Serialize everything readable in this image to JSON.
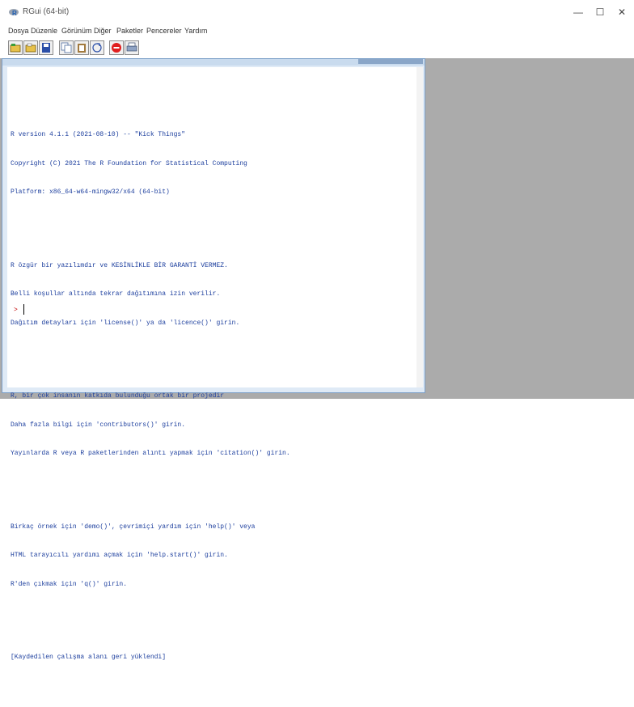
{
  "window": {
    "title": "RGui (64-bit)",
    "controls": {
      "minimize": "—",
      "maximize": "☐",
      "close": "✕"
    }
  },
  "menu": {
    "items": [
      "Dosya",
      "Düzenle",
      "Görünüm",
      "Diğer",
      "Paketler",
      "Pencereler",
      "Yardım"
    ]
  },
  "toolbar": {
    "buttons": [
      "open-script",
      "load-workspace",
      "save-workspace",
      "copy",
      "paste",
      "copy-paste",
      "stop",
      "print"
    ]
  },
  "console": {
    "paragraphs": [
      [
        "R version 4.1.1 (2021-08-10) -- \"Kick Things\"",
        "Copyright (C) 2021 The R Foundation for Statistical Computing",
        "Platform: x86_64-w64-mingw32/x64 (64-bit)"
      ],
      [
        "R özgür bir yazılımdır ve KESİNLİKLE BİR GARANTİ VERMEZ.",
        "Belli koşullar altında tekrar dağıtımına izin verilir.",
        "Dağıtım detayları için 'license()' ya da 'licence()' girin."
      ],
      [
        "R, bir çok insanın katkıda bulunduğu ortak bir projedir",
        "Daha fazla bilgi için 'contributors()' girin.",
        "Yayınlarda R veya R paketlerinden alıntı yapmak için 'citation()' girin."
      ],
      [
        "Birkaç örnek için 'demo()', çevrimiçi yardım için 'help()' veya",
        "HTML tarayıcılı yardımı açmak için 'help.start()' girin.",
        "R'den çıkmak için 'q()' girin."
      ],
      [
        "[Kaydedilen çalışma alanı geri yüklendi]"
      ]
    ],
    "prompt": ">"
  }
}
